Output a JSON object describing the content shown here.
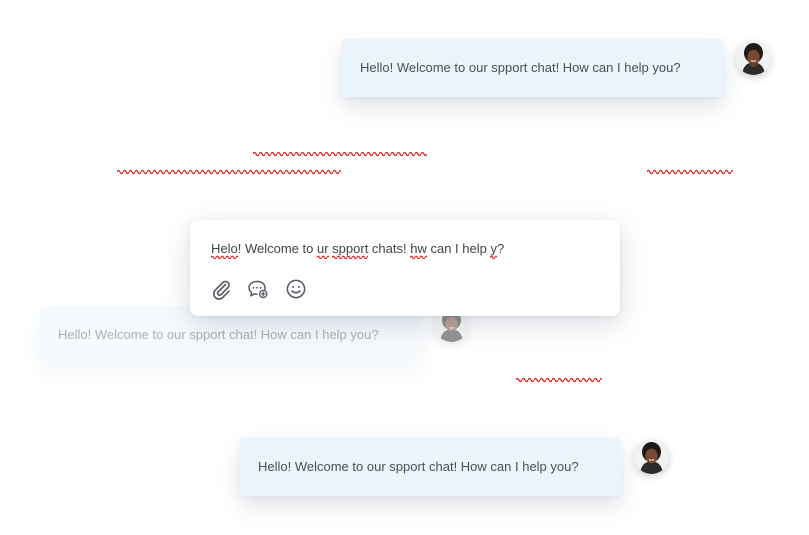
{
  "messages": [
    {
      "text": "Hello! Welcome to our spport chat! How can I help you?"
    },
    {
      "text": "Hello! Welcome to our spport chat! How can I help you?"
    },
    {
      "text": "Hello! Welcome to our spport chat! How can I help you?"
    }
  ],
  "composer": {
    "segments": [
      {
        "text": "Helo",
        "error": true
      },
      {
        "text": "! Welcome to ",
        "error": false
      },
      {
        "text": "ur",
        "error": true
      },
      {
        "text": " ",
        "error": false
      },
      {
        "text": "spport",
        "error": true
      },
      {
        "text": " chats! ",
        "error": false
      },
      {
        "text": "hw",
        "error": true
      },
      {
        "text": " can I help ",
        "error": false
      },
      {
        "text": "y",
        "error": true
      },
      {
        "text": "?",
        "error": false
      }
    ]
  },
  "toolbar": {
    "icons": [
      "paperclip-icon",
      "chat-add-icon",
      "smiley-icon"
    ]
  },
  "colors": {
    "bubble_bg": "#eaf4fd",
    "text": "#4a4f57",
    "spellcheck": "#e02020",
    "icon": "#555b63"
  }
}
